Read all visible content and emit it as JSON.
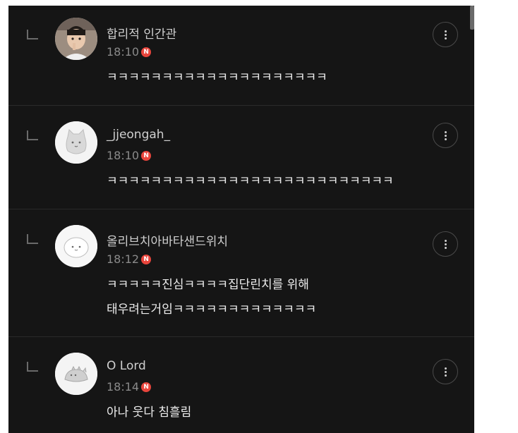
{
  "comments": [
    {
      "username": "합리적 인간관",
      "time": "18:10",
      "badge": "N",
      "text_lines": [
        "ㅋㅋㅋㅋㅋㅋㅋㅋㅋㅋㅋㅋㅋㅋㅋㅋㅋㅋㅋㅋ"
      ],
      "avatar_icon": "profile-photo-icon"
    },
    {
      "username": "_jjeongah_",
      "time": "18:10",
      "badge": "N",
      "text_lines": [
        "ㅋㅋㅋㅋㅋㅋㅋㅋㅋㅋㅋㅋㅋㅋㅋㅋㅋㅋㅋㅋㅋㅋㅋㅋㅋㅋ"
      ],
      "avatar_icon": "cat-avatar-icon"
    },
    {
      "username": "올리브치아바타샌드위치",
      "time": "18:12",
      "badge": "N",
      "text_lines": [
        "ㅋㅋㅋㅋㅋ진심ㅋㅋㅋㅋ집단린치를 위해",
        "태우려는거임ㅋㅋㅋㅋㅋㅋㅋㅋㅋㅋㅋㅋㅋ"
      ],
      "avatar_icon": "blob-avatar-icon"
    },
    {
      "username": "O Lord",
      "time": "18:14",
      "badge": "N",
      "text_lines": [
        "아나 웃다 침흘림"
      ],
      "avatar_icon": "dino-avatar-icon"
    }
  ],
  "colors": {
    "background": "#151515",
    "username": "#cfcfcf",
    "time": "#8a8a8a",
    "badge": "#e8453c",
    "text": "#ededed"
  },
  "more_icon": "more-vertical-icon",
  "reply_icon": "reply-arrow-icon"
}
